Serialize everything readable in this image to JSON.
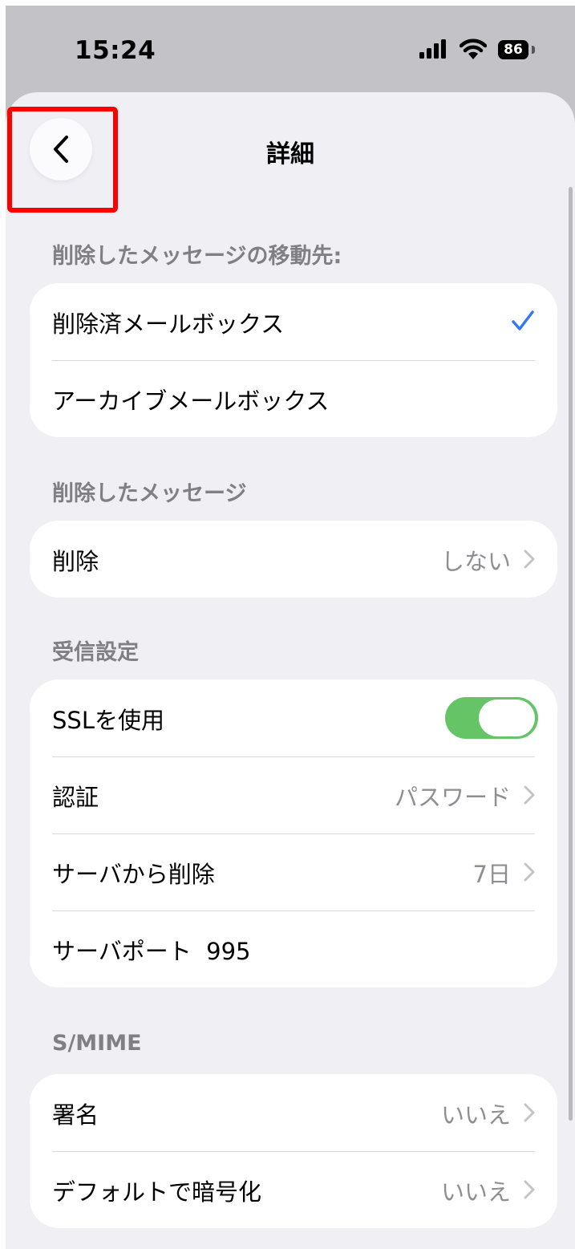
{
  "status_bar": {
    "time": "15:24",
    "battery": "86"
  },
  "nav": {
    "title": "詳細"
  },
  "sections": {
    "deleted_dest": {
      "header": "削除したメッセージの移動先:",
      "rows": [
        {
          "label": "削除済メールボックス",
          "selected": true
        },
        {
          "label": "アーカイブメールボックス",
          "selected": false
        }
      ]
    },
    "deleted_messages": {
      "header": "削除したメッセージ",
      "rows": [
        {
          "label": "削除",
          "value": "しない"
        }
      ]
    },
    "incoming": {
      "header": "受信設定",
      "rows": [
        {
          "label": "SSLを使用",
          "toggle_on": true
        },
        {
          "label": "認証",
          "value": "パスワード"
        },
        {
          "label": "サーバから削除",
          "value": "7日"
        },
        {
          "label": "サーバポート",
          "value": "995"
        }
      ]
    },
    "smime": {
      "header": "S/MIME",
      "rows": [
        {
          "label": "署名",
          "value": "いいえ"
        },
        {
          "label": "デフォルトで暗号化",
          "value": "いいえ"
        }
      ]
    }
  },
  "colors": {
    "accent": "#3478f6",
    "toggle_on": "#65c466",
    "highlight": "#ff0000"
  },
  "icons": [
    "back-chevron-icon",
    "checkmark-icon",
    "chevron-right-icon",
    "signal-icon",
    "wifi-icon",
    "battery-icon"
  ]
}
